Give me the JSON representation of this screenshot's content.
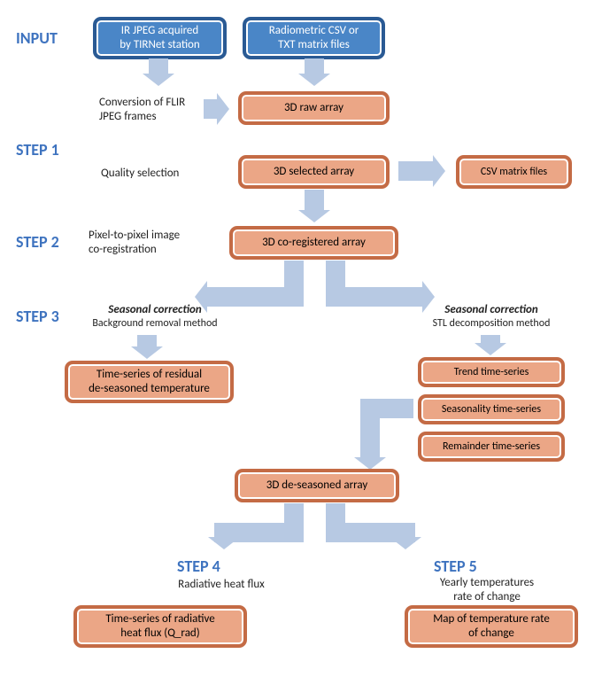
{
  "labels": {
    "input": "INPUT",
    "step1": "STEP 1",
    "step2": "STEP 2",
    "step3": "STEP 3",
    "step4": "STEP 4",
    "step5": "STEP 5"
  },
  "sub": {
    "conversion": "Conversion of FLIR\nJPEG frames",
    "quality": "Quality selection",
    "coreg": "Pixel-to-pixel image\nco-registration",
    "seasonalL_title": "Seasonal correction",
    "seasonalL_sub": "Background removal method",
    "seasonalR_title": "Seasonal correction",
    "seasonalR_sub": "STL decomposition method",
    "radiative": "Radiative heat flux",
    "yearly": "Yearly temperatures\nrate of change"
  },
  "boxes": {
    "input_ir": "IR JPEG acquired\nby TIRNet station",
    "input_csv": "Radiometric CSV or\nTXT matrix files",
    "raw3d": "3D raw array",
    "selected3d": "3D selected array",
    "csvout": "CSV matrix files",
    "coreg3d": "3D co-registered array",
    "residual": "Time-series of residual\nde-seasoned temperature",
    "trend": "Trend time-series",
    "seasonality": "Seasonality  time-series",
    "remainder": "Remainder  time-series",
    "deseasoned3d": "3D de-seasoned array",
    "qrad": "Time-series of radiative\nheat flux (Q_rad)",
    "map": "Map of temperature rate\nof change"
  }
}
